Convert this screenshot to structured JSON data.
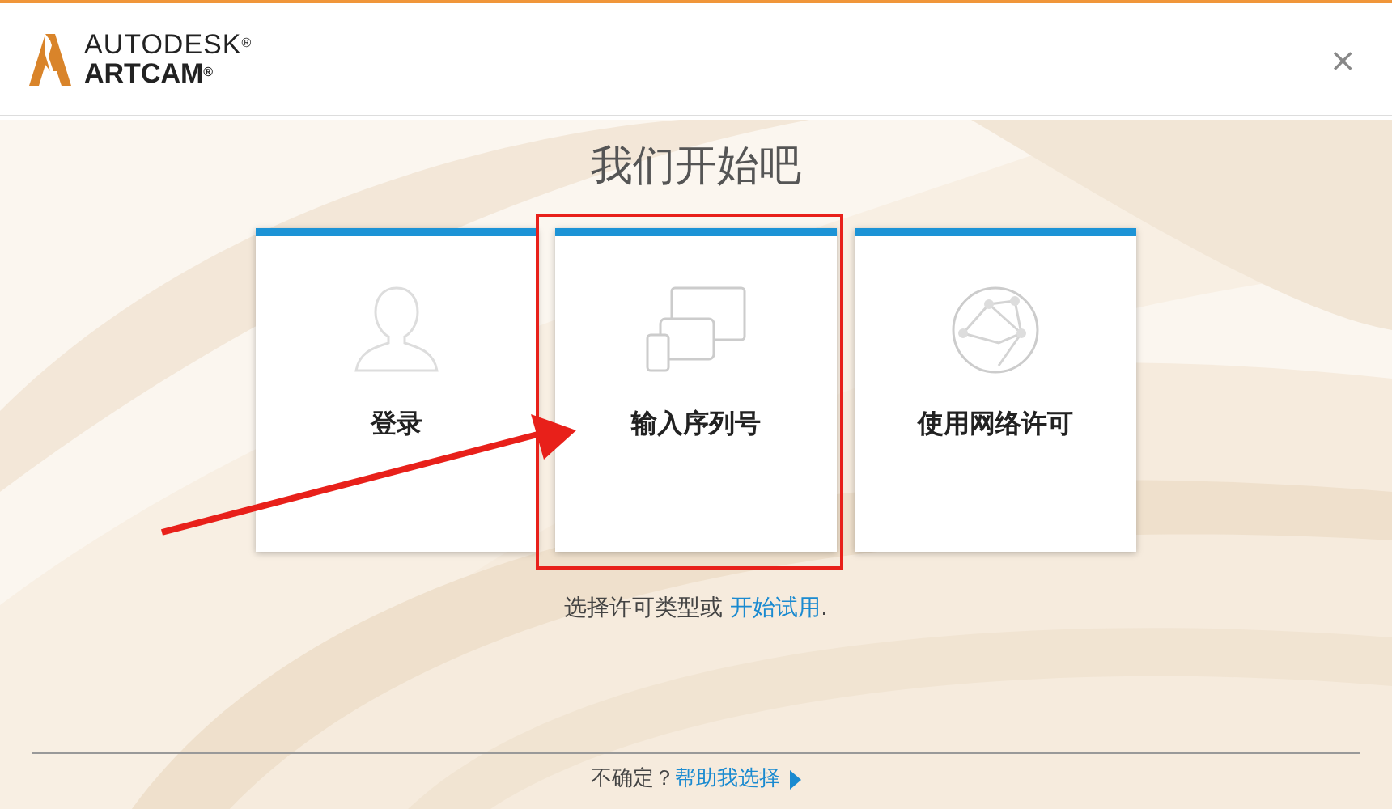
{
  "header": {
    "brand_top": "AUTODESK$^{®}$",
    "brand_bottom": "ARTCAM$^{®}$",
    "close": "×"
  },
  "title": "我们开始吧",
  "cards": [
    {
      "kind": "person",
      "label": "登录",
      "highlighted": false
    },
    {
      "kind": "devices",
      "label": "输入序列号",
      "highlighted": true
    },
    {
      "kind": "network",
      "label": "使用网络许可",
      "highlighted": false
    }
  ],
  "prompt": {
    "text": "选择许可类型或 ",
    "link": "开始试用",
    "end": "."
  },
  "footer": {
    "text": "不确定？",
    "link": "帮助我选择"
  }
}
